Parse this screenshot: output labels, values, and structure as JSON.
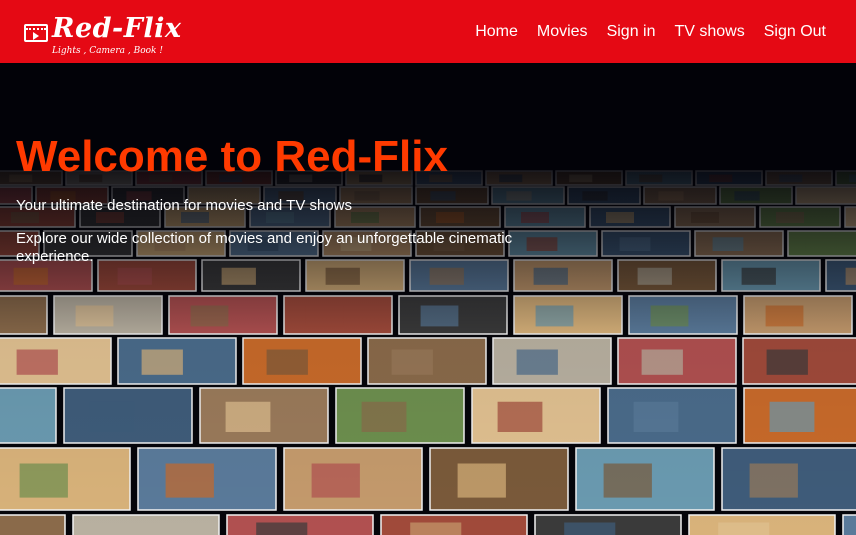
{
  "brand": {
    "name": "Red-Flix",
    "tagline": "Lights , Camera , Book !",
    "icon": "film-play-icon"
  },
  "nav": {
    "items": [
      {
        "label": "Home"
      },
      {
        "label": "Movies"
      },
      {
        "label": "Sign in"
      },
      {
        "label": "TV shows"
      },
      {
        "label": "Sign Out"
      }
    ]
  },
  "hero": {
    "title": "Welcome to Red-Flix",
    "subtitle": "Your ultimate destination for movies and TV shows",
    "description": "Explore our wide collection of movies and enjoy an unforgettable cinematic experience."
  },
  "colors": {
    "navbar": "#e50914",
    "title": "#ff3a00",
    "background": "#05050a",
    "text": "#ffffff"
  }
}
